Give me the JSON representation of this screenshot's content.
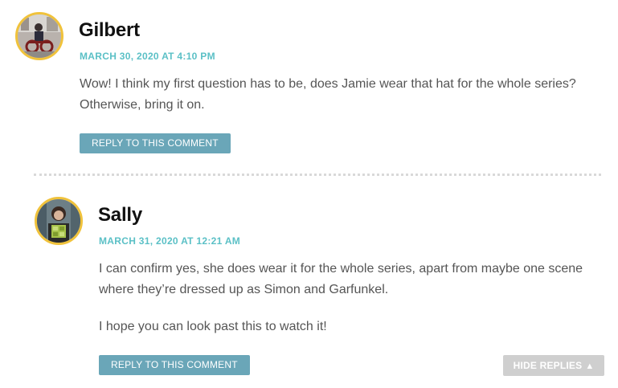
{
  "comments": [
    {
      "author": "Gilbert",
      "date": "MARCH 30, 2020 AT 4:10 PM",
      "paragraphs": [
        "Wow! I think my first question has to be, does Jamie wear that hat for the whole series?",
        "Otherwise, bring it on."
      ],
      "reply_label": "REPLY TO THIS COMMENT"
    },
    {
      "author": "Sally",
      "date": "MARCH 31, 2020 AT 12:21 AM",
      "paragraphs": [
        "I can confirm yes, she does wear it for the whole series, apart from maybe one scene",
        "where they’re dressed up as Simon and Garfunkel.",
        "I hope you can look past this to watch it!"
      ],
      "reply_label": "REPLY TO THIS COMMENT"
    }
  ],
  "hide_replies": {
    "label": "HIDE REPLIES",
    "icon": "triangle-up-icon"
  },
  "colors": {
    "avatar_ring": "#f0c23b",
    "date": "#5bc0c6",
    "reply_button": "#6aa6b8",
    "hide_button": "#cfcfcf"
  }
}
